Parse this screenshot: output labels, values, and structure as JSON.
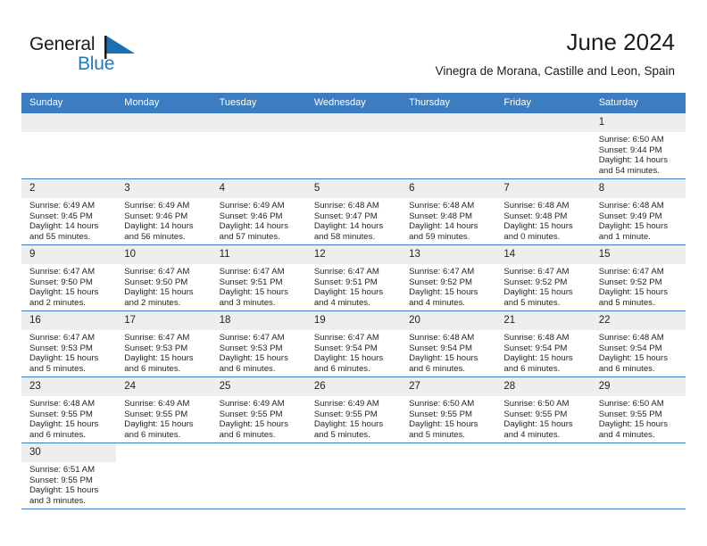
{
  "brand": {
    "name_part1": "General",
    "name_part2": "Blue",
    "flag_color": "#1a6fb5",
    "blue_text_color": "#1a7bc4"
  },
  "header": {
    "title": "June 2024",
    "subtitle": "Vinegra de Morana, Castille and Leon, Spain"
  },
  "theme": {
    "header_row_bg": "#3b7dc0",
    "daynum_bg": "#eeeeee",
    "grid_line": "#3b7dc0"
  },
  "weekdays": [
    "Sunday",
    "Monday",
    "Tuesday",
    "Wednesday",
    "Thursday",
    "Friday",
    "Saturday"
  ],
  "labels": {
    "sunrise": "Sunrise:",
    "sunset": "Sunset:",
    "daylight": "Daylight:"
  },
  "weeks": [
    [
      {
        "day": "",
        "empty": true
      },
      {
        "day": "",
        "empty": true
      },
      {
        "day": "",
        "empty": true
      },
      {
        "day": "",
        "empty": true
      },
      {
        "day": "",
        "empty": true
      },
      {
        "day": "",
        "empty": true
      },
      {
        "day": "1",
        "sunrise": "Sunrise: 6:50 AM",
        "sunset": "Sunset: 9:44 PM",
        "daylight": "Daylight: 14 hours and 54 minutes."
      }
    ],
    [
      {
        "day": "2",
        "sunrise": "Sunrise: 6:49 AM",
        "sunset": "Sunset: 9:45 PM",
        "daylight": "Daylight: 14 hours and 55 minutes."
      },
      {
        "day": "3",
        "sunrise": "Sunrise: 6:49 AM",
        "sunset": "Sunset: 9:46 PM",
        "daylight": "Daylight: 14 hours and 56 minutes."
      },
      {
        "day": "4",
        "sunrise": "Sunrise: 6:49 AM",
        "sunset": "Sunset: 9:46 PM",
        "daylight": "Daylight: 14 hours and 57 minutes."
      },
      {
        "day": "5",
        "sunrise": "Sunrise: 6:48 AM",
        "sunset": "Sunset: 9:47 PM",
        "daylight": "Daylight: 14 hours and 58 minutes."
      },
      {
        "day": "6",
        "sunrise": "Sunrise: 6:48 AM",
        "sunset": "Sunset: 9:48 PM",
        "daylight": "Daylight: 14 hours and 59 minutes."
      },
      {
        "day": "7",
        "sunrise": "Sunrise: 6:48 AM",
        "sunset": "Sunset: 9:48 PM",
        "daylight": "Daylight: 15 hours and 0 minutes."
      },
      {
        "day": "8",
        "sunrise": "Sunrise: 6:48 AM",
        "sunset": "Sunset: 9:49 PM",
        "daylight": "Daylight: 15 hours and 1 minute."
      }
    ],
    [
      {
        "day": "9",
        "sunrise": "Sunrise: 6:47 AM",
        "sunset": "Sunset: 9:50 PM",
        "daylight": "Daylight: 15 hours and 2 minutes."
      },
      {
        "day": "10",
        "sunrise": "Sunrise: 6:47 AM",
        "sunset": "Sunset: 9:50 PM",
        "daylight": "Daylight: 15 hours and 2 minutes."
      },
      {
        "day": "11",
        "sunrise": "Sunrise: 6:47 AM",
        "sunset": "Sunset: 9:51 PM",
        "daylight": "Daylight: 15 hours and 3 minutes."
      },
      {
        "day": "12",
        "sunrise": "Sunrise: 6:47 AM",
        "sunset": "Sunset: 9:51 PM",
        "daylight": "Daylight: 15 hours and 4 minutes."
      },
      {
        "day": "13",
        "sunrise": "Sunrise: 6:47 AM",
        "sunset": "Sunset: 9:52 PM",
        "daylight": "Daylight: 15 hours and 4 minutes."
      },
      {
        "day": "14",
        "sunrise": "Sunrise: 6:47 AM",
        "sunset": "Sunset: 9:52 PM",
        "daylight": "Daylight: 15 hours and 5 minutes."
      },
      {
        "day": "15",
        "sunrise": "Sunrise: 6:47 AM",
        "sunset": "Sunset: 9:52 PM",
        "daylight": "Daylight: 15 hours and 5 minutes."
      }
    ],
    [
      {
        "day": "16",
        "sunrise": "Sunrise: 6:47 AM",
        "sunset": "Sunset: 9:53 PM",
        "daylight": "Daylight: 15 hours and 5 minutes."
      },
      {
        "day": "17",
        "sunrise": "Sunrise: 6:47 AM",
        "sunset": "Sunset: 9:53 PM",
        "daylight": "Daylight: 15 hours and 6 minutes."
      },
      {
        "day": "18",
        "sunrise": "Sunrise: 6:47 AM",
        "sunset": "Sunset: 9:53 PM",
        "daylight": "Daylight: 15 hours and 6 minutes."
      },
      {
        "day": "19",
        "sunrise": "Sunrise: 6:47 AM",
        "sunset": "Sunset: 9:54 PM",
        "daylight": "Daylight: 15 hours and 6 minutes."
      },
      {
        "day": "20",
        "sunrise": "Sunrise: 6:48 AM",
        "sunset": "Sunset: 9:54 PM",
        "daylight": "Daylight: 15 hours and 6 minutes."
      },
      {
        "day": "21",
        "sunrise": "Sunrise: 6:48 AM",
        "sunset": "Sunset: 9:54 PM",
        "daylight": "Daylight: 15 hours and 6 minutes."
      },
      {
        "day": "22",
        "sunrise": "Sunrise: 6:48 AM",
        "sunset": "Sunset: 9:54 PM",
        "daylight": "Daylight: 15 hours and 6 minutes."
      }
    ],
    [
      {
        "day": "23",
        "sunrise": "Sunrise: 6:48 AM",
        "sunset": "Sunset: 9:55 PM",
        "daylight": "Daylight: 15 hours and 6 minutes."
      },
      {
        "day": "24",
        "sunrise": "Sunrise: 6:49 AM",
        "sunset": "Sunset: 9:55 PM",
        "daylight": "Daylight: 15 hours and 6 minutes."
      },
      {
        "day": "25",
        "sunrise": "Sunrise: 6:49 AM",
        "sunset": "Sunset: 9:55 PM",
        "daylight": "Daylight: 15 hours and 6 minutes."
      },
      {
        "day": "26",
        "sunrise": "Sunrise: 6:49 AM",
        "sunset": "Sunset: 9:55 PM",
        "daylight": "Daylight: 15 hours and 5 minutes."
      },
      {
        "day": "27",
        "sunrise": "Sunrise: 6:50 AM",
        "sunset": "Sunset: 9:55 PM",
        "daylight": "Daylight: 15 hours and 5 minutes."
      },
      {
        "day": "28",
        "sunrise": "Sunrise: 6:50 AM",
        "sunset": "Sunset: 9:55 PM",
        "daylight": "Daylight: 15 hours and 4 minutes."
      },
      {
        "day": "29",
        "sunrise": "Sunrise: 6:50 AM",
        "sunset": "Sunset: 9:55 PM",
        "daylight": "Daylight: 15 hours and 4 minutes."
      }
    ],
    [
      {
        "day": "30",
        "sunrise": "Sunrise: 6:51 AM",
        "sunset": "Sunset: 9:55 PM",
        "daylight": "Daylight: 15 hours and 3 minutes."
      },
      {
        "day": "",
        "empty": true,
        "blank": true
      },
      {
        "day": "",
        "empty": true,
        "blank": true
      },
      {
        "day": "",
        "empty": true,
        "blank": true
      },
      {
        "day": "",
        "empty": true,
        "blank": true
      },
      {
        "day": "",
        "empty": true,
        "blank": true
      },
      {
        "day": "",
        "empty": true,
        "blank": true
      }
    ]
  ]
}
